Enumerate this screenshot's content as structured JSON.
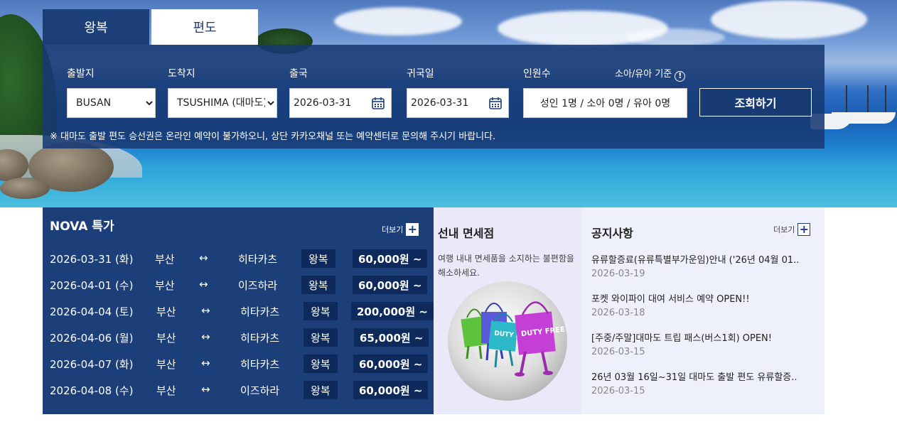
{
  "tabs": {
    "round_trip": "왕복",
    "one_way": "편도"
  },
  "search": {
    "departure_label": "출발지",
    "arrival_label": "도착지",
    "outbound_label": "출국",
    "return_label": "귀국일",
    "pax_label": "인원수",
    "infant_label": "소아/유아 기준",
    "departure_value": "BUSAN",
    "arrival_value": "TSUSHIMA (대마도)",
    "outbound_date": "2026-03-31",
    "return_date": "2026-03-31",
    "pax_value": "성인 1명 / 소아 0명 / 유아 0명",
    "search_button": "조회하기",
    "notice": "※ 대마도 출발 편도 승선권은 온라인 예약이 불가하오니, 상단 카카오채널 또는 예약센터로 문의해 주시기 바랍니다."
  },
  "deals": {
    "title": "NOVA 특가",
    "more_label": "더보기",
    "rows": [
      {
        "date": "2026-03-31 (화)",
        "from": "부산",
        "arrow": "↔",
        "to": "히타카츠",
        "type": "왕복",
        "price": "60,000원 ~"
      },
      {
        "date": "2026-04-01 (수)",
        "from": "부산",
        "arrow": "↔",
        "to": "이즈하라",
        "type": "왕복",
        "price": "60,000원 ~"
      },
      {
        "date": "2026-04-04 (토)",
        "from": "부산",
        "arrow": "↔",
        "to": "히타카츠",
        "type": "왕복",
        "price": "200,000원 ~"
      },
      {
        "date": "2026-04-06 (월)",
        "from": "부산",
        "arrow": "↔",
        "to": "히타카츠",
        "type": "왕복",
        "price": "65,000원 ~"
      },
      {
        "date": "2026-04-07 (화)",
        "from": "부산",
        "arrow": "↔",
        "to": "히타카츠",
        "type": "왕복",
        "price": "60,000원 ~"
      },
      {
        "date": "2026-04-08 (수)",
        "from": "부산",
        "arrow": "↔",
        "to": "이즈하라",
        "type": "왕복",
        "price": "60,000원 ~"
      }
    ]
  },
  "dutyfree": {
    "title": "선내 면세점",
    "description": "여행 내내 면세품을 소지하는 불편함을 해소하세요.",
    "bag_text_1": "DUTY FREE",
    "bag_text_2": "DUTY FREE"
  },
  "notices": {
    "title": "공지사항",
    "more_label": "더보기",
    "items": [
      {
        "title": "유류할증료(유류특별부가운임)안내 ('26년 04월 01..",
        "date": "2026-03-19"
      },
      {
        "title": "포켓 와이파이 대여 서비스 예약 OPEN!!",
        "date": "2026-03-18"
      },
      {
        "title": "[주중/주말]대마도 트립 패스(버스1회) OPEN!",
        "date": "2026-03-15"
      },
      {
        "title": "26년 03월 16일~31일 대마도 출발 편도 유류할증..",
        "date": "2026-03-15"
      }
    ]
  }
}
